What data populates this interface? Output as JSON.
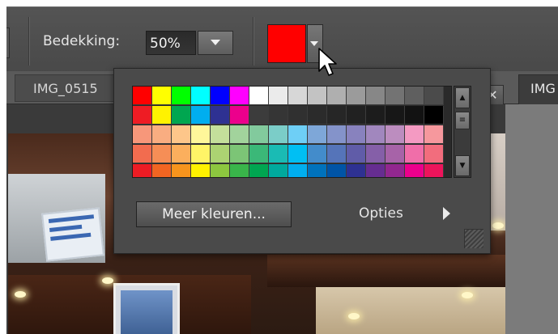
{
  "options_bar": {
    "opacity_label": "Bedekking:",
    "opacity_value": "50%",
    "color_swatch": "#ff0000"
  },
  "tabs": [
    {
      "label": "IMG_0515"
    },
    {
      "label": "IMG"
    }
  ],
  "color_picker": {
    "rows": [
      [
        "#ff0000",
        "#ffff00",
        "#00ff00",
        "#00ffff",
        "#0000ff",
        "#ff00ff",
        "#ffffff",
        "#ebebeb",
        "#d7d7d7",
        "#c3c3c3",
        "#afafaf",
        "#9b9b9b",
        "#878787",
        "#737373",
        "#5f5f5f",
        "#4b4b4b"
      ],
      [
        "#ee1c24",
        "#fff200",
        "#00a650",
        "#00aeef",
        "#2e3192",
        "#ec008c",
        "#3c3c3c",
        "#353535",
        "#303030",
        "#2b2b2b",
        "#262626",
        "#212121",
        "#1c1c1c",
        "#171717",
        "#121212",
        "#000000"
      ],
      [
        "#f7977a",
        "#f9ad81",
        "#fdc68a",
        "#fff79a",
        "#c4df9b",
        "#a2d39c",
        "#82ca9d",
        "#7bcdc8",
        "#6ecff6",
        "#7ea7d8",
        "#8493ca",
        "#8882be",
        "#a187be",
        "#bc8dbf",
        "#f49ac2",
        "#f6989d"
      ],
      [
        "#f26c4f",
        "#f68e56",
        "#fbaf5d",
        "#fff467",
        "#acd372",
        "#7cc576",
        "#3bb878",
        "#1abbb4",
        "#00bff3",
        "#438ccb",
        "#5574b9",
        "#605ca8",
        "#855fa8",
        "#a763a8",
        "#f06ea9",
        "#f26d7d"
      ],
      [
        "#ed1c24",
        "#f26522",
        "#f7941d",
        "#fff200",
        "#8dc73f",
        "#39b54a",
        "#00a651",
        "#00a99d",
        "#00aeef",
        "#0072bc",
        "#0054a6",
        "#2e3192",
        "#662d91",
        "#92278f",
        "#ec008c",
        "#ed145b"
      ]
    ],
    "more_colors_label": "Meer kleuren...",
    "options_label": "Opties"
  }
}
